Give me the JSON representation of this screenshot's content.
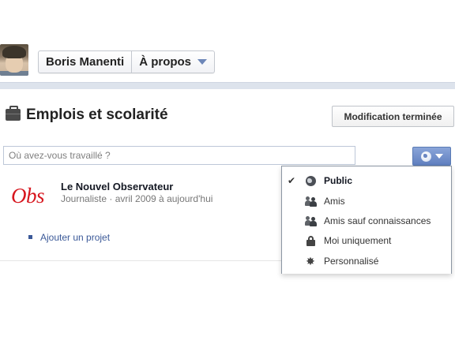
{
  "profile": {
    "name": "Boris Manenti",
    "about_label": "À propos"
  },
  "section": {
    "title": "Emplois et scolarité",
    "done_button": "Modification terminée"
  },
  "work_input": {
    "placeholder": "Où avez-vous travaillé ?",
    "value": ""
  },
  "job": {
    "logo_text": "Obs",
    "employer": "Le Nouvel Observateur",
    "details": "Journaliste · avril 2009 à aujourd'hui"
  },
  "add_project_label": "Ajouter un projet",
  "privacy_menu": {
    "selected": "Public",
    "items": [
      {
        "label": "Public",
        "icon": "globe-icon",
        "checked": true
      },
      {
        "label": "Amis",
        "icon": "friends-icon",
        "checked": false
      },
      {
        "label": "Amis sauf connaissances",
        "icon": "friends-except-acquaintances-icon",
        "checked": false
      },
      {
        "label": "Moi uniquement",
        "icon": "lock-icon",
        "checked": false
      },
      {
        "label": "Personnalisé",
        "icon": "gear-icon",
        "checked": false
      }
    ]
  },
  "colors": {
    "link": "#3b5998",
    "logo_red": "#d7171f",
    "privacy_button": "#6d87c4"
  }
}
